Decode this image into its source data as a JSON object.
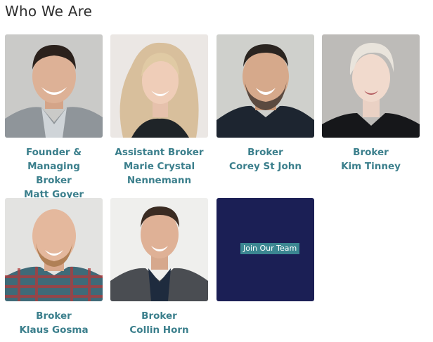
{
  "page": {
    "title": "Who We Are"
  },
  "team": [
    {
      "role_line1": "Founder & Managing",
      "role_line2": "Broker",
      "name": "Matt Goyer",
      "photo": "portrait-matt-goyer"
    },
    {
      "role_line1": "Assistant Broker",
      "role_line2": "Marie Crystal",
      "name": "Nennemann",
      "photo": "portrait-marie-crystal-nennemann"
    },
    {
      "role_line1": "Broker",
      "role_line2": "",
      "name": "Corey St John",
      "photo": "portrait-corey-st-john"
    },
    {
      "role_line1": "Broker",
      "role_line2": "",
      "name": "Kim Tinney",
      "photo": "portrait-kim-tinney"
    },
    {
      "role_line1": "Broker",
      "role_line2": "",
      "name": "Klaus Gosma",
      "photo": "portrait-klaus-gosma"
    },
    {
      "role_line1": "Broker",
      "role_line2": "",
      "name": "Collin Horn",
      "photo": "portrait-collin-horn"
    }
  ],
  "join": {
    "label": "Join Our Team"
  },
  "colors": {
    "accent_text": "#3b7f8c",
    "join_tile": "#1b1f55",
    "join_button": "#3b8691"
  }
}
